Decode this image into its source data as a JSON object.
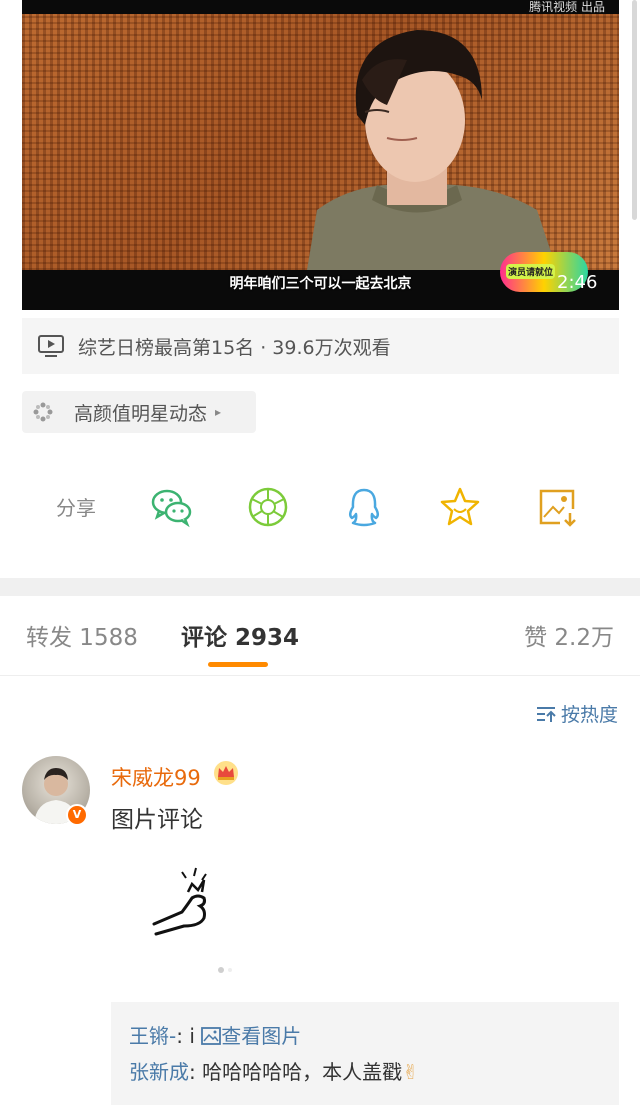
{
  "video": {
    "watermark": "腾讯视频 出品",
    "subtitle": "明年咱们三个可以一起去北京",
    "badge_text": "演员请就位",
    "duration": "2:46"
  },
  "stats": {
    "icon": "tv-play-icon",
    "text": "综艺日榜最高第15名 · 39.6万次观看"
  },
  "topic": {
    "icon": "sparkle-icon",
    "label": "高颜值明星动态",
    "arrow": "▸"
  },
  "share": {
    "label": "分享",
    "targets": [
      {
        "name": "wechat",
        "icon": "wechat-icon",
        "color": "#3cb371"
      },
      {
        "name": "moments",
        "icon": "moments-icon",
        "color": "#7ccb3a"
      },
      {
        "name": "qq",
        "icon": "qq-icon",
        "color": "#4aa8e0"
      },
      {
        "name": "favorite",
        "icon": "star-icon",
        "color": "#f0b400"
      },
      {
        "name": "save-image",
        "icon": "save-image-icon",
        "color": "#e0a020"
      }
    ]
  },
  "tabs": {
    "repost": "转发 1588",
    "comments": "评论 2934",
    "likes": "赞 2.2万",
    "active_color": "#ff8a00"
  },
  "sort": {
    "label": "按热度",
    "icon": "sort-icon"
  },
  "comment": {
    "username": "宋威龙99",
    "verified_badge": "V",
    "text": "图片评论",
    "username_color": "#e86a0c",
    "replies": [
      {
        "name": "王锵-",
        "sep": ": ",
        "text": "i ",
        "link": "查看图片"
      },
      {
        "name": "张新成",
        "sep": ": ",
        "text": "哈哈哈哈哈，本人盖戳",
        "emoji": "✌"
      }
    ]
  }
}
